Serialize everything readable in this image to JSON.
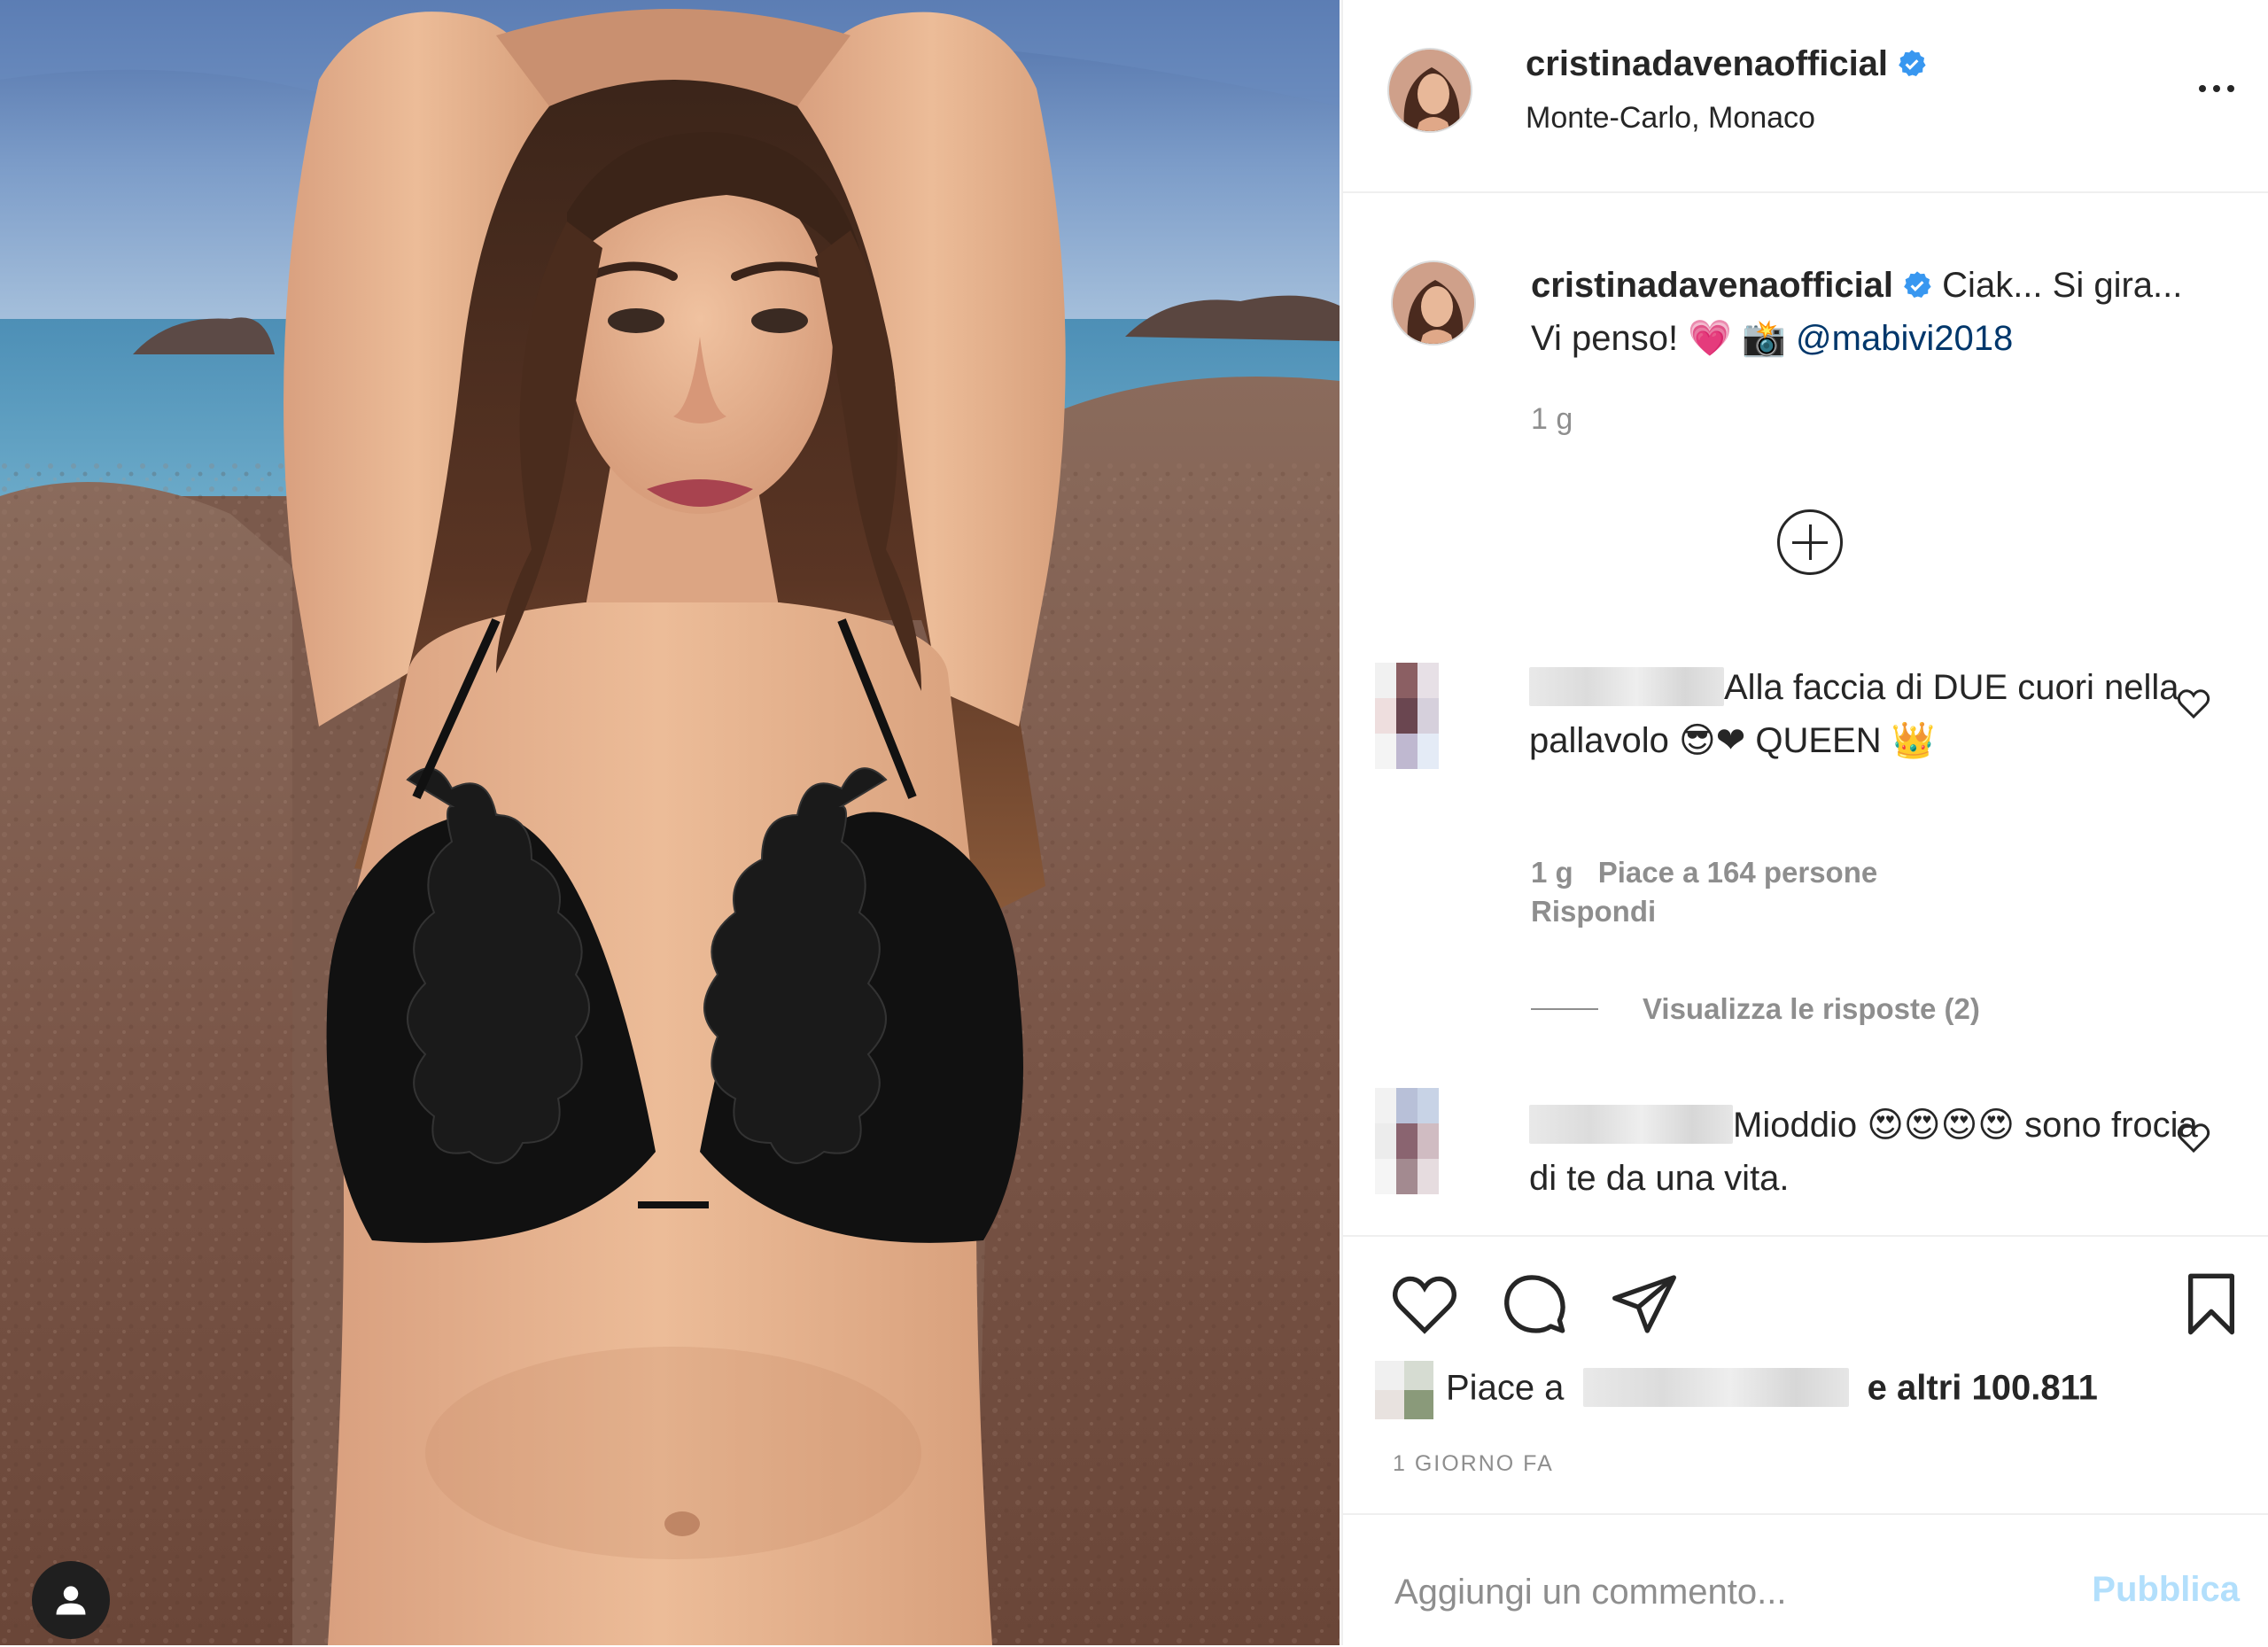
{
  "post": {
    "username": "cristinadavenaofficial",
    "location": "Monte-Carlo, Monaco",
    "verified": true
  },
  "caption": {
    "username": "cristinadavenaofficial",
    "text_1": "Ciak... Si gira... Vi penso! ",
    "emoji_heart": "💗",
    "emoji_camera": "📸",
    "mention": "@mabivi2018",
    "time": "1 g"
  },
  "comments": [
    {
      "text": "Alla faccia di DUE cuori nella pallavolo 😎❤ QUEEN 👑",
      "time": "1 g",
      "likes": "Piace a 164 persone",
      "reply": "Rispondi",
      "view_replies": "Visualizza le risposte (2)"
    },
    {
      "text": "Mioddio 😍😍😍😍 sono frocia di te da una vita."
    }
  ],
  "likes": {
    "prefix": "Piace a",
    "suffix": "e altri 100.811"
  },
  "date": "1 GIORNO FA",
  "add_comment": {
    "placeholder": "Aggiungi un commento...",
    "publish": "Pubblica"
  },
  "icons": [
    "more-options-icon",
    "verified-icon",
    "add-icon",
    "heart-icon",
    "comment-icon",
    "share-icon",
    "bookmark-icon",
    "user-tag-icon"
  ],
  "colors": {
    "verified": "#3897f0",
    "link": "#00376b",
    "publish_disabled": "#b2dffc",
    "muted": "#8e8e8e"
  }
}
